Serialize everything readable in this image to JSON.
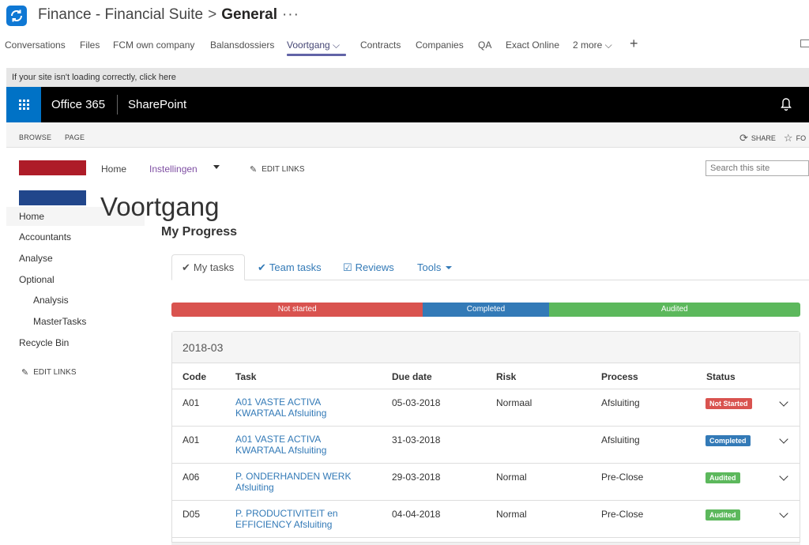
{
  "teams": {
    "team_name": "Finance - Financial Suite",
    "separator": ">",
    "channel": "General",
    "more": "···",
    "tabs": [
      {
        "label": "Conversations"
      },
      {
        "label": "Files"
      },
      {
        "label": "FCM own company"
      },
      {
        "label": "Balansdossiers"
      },
      {
        "label": "Voortgang ⌵"
      },
      {
        "label": "Contracts"
      },
      {
        "label": "Companies"
      },
      {
        "label": "QA"
      },
      {
        "label": "Exact Online"
      },
      {
        "label": "2 more ⌵"
      }
    ],
    "add_tab": "+"
  },
  "notice": "If your site isn't loading correctly, click here",
  "suitebar": {
    "office": "Office 365",
    "app": "SharePoint"
  },
  "ribbon": {
    "browse": "BROWSE",
    "page": "PAGE",
    "share": "SHARE",
    "follow": "FO"
  },
  "site": {
    "topnav": {
      "home": "Home",
      "settings": "Instellingen"
    },
    "edit_links": "EDIT LINKS",
    "search_placeholder": "Search this site",
    "page_title": "Voortgang"
  },
  "leftnav": {
    "items": [
      {
        "label": "Home"
      },
      {
        "label": "Accountants"
      },
      {
        "label": "Analyse"
      },
      {
        "label": "Optional"
      },
      {
        "label": "Analysis"
      },
      {
        "label": "MasterTasks"
      },
      {
        "label": "Recycle Bin"
      }
    ],
    "edit_links": "EDIT LINKS"
  },
  "content": {
    "heading": "My Progress",
    "tabs": {
      "my_tasks": "My tasks",
      "team_tasks": "Team tasks",
      "reviews": "Reviews",
      "tools": "Tools"
    },
    "progress": [
      {
        "label": "Not started",
        "fraction": 0.4,
        "color": "#d9534f"
      },
      {
        "label": "Completed",
        "fraction": 0.2,
        "color": "#337ab7"
      },
      {
        "label": "Audited",
        "fraction": 0.4,
        "color": "#5cb85c"
      }
    ],
    "panel_title": "2018-03",
    "columns": {
      "code": "Code",
      "task": "Task",
      "due": "Due date",
      "risk": "Risk",
      "process": "Process",
      "status": "Status"
    },
    "rows": [
      {
        "code": "A01",
        "task": "A01 VASTE ACTIVA KWARTAAL Afsluiting",
        "due": "05-03-2018",
        "risk": "Normaal",
        "process": "Afsluiting",
        "status": "Not Started",
        "status_color": "#d9534f"
      },
      {
        "code": "A01",
        "task": "A01 VASTE ACTIVA KWARTAAL Afsluiting",
        "due": "31-03-2018",
        "risk": "",
        "process": "Afsluiting",
        "status": "Completed",
        "status_color": "#337ab7"
      },
      {
        "code": "A06",
        "task": "P. ONDERHANDEN WERK Afsluiting",
        "due": "29-03-2018",
        "risk": "Normal",
        "process": "Pre-Close",
        "status": "Audited",
        "status_color": "#5cb85c"
      },
      {
        "code": "D05",
        "task": "P. PRODUCTIVITEIT en EFFICIENCY Afsluiting",
        "due": "04-04-2018",
        "risk": "Normal",
        "process": "Pre-Close",
        "status": "Audited",
        "status_color": "#5cb85c"
      }
    ]
  }
}
